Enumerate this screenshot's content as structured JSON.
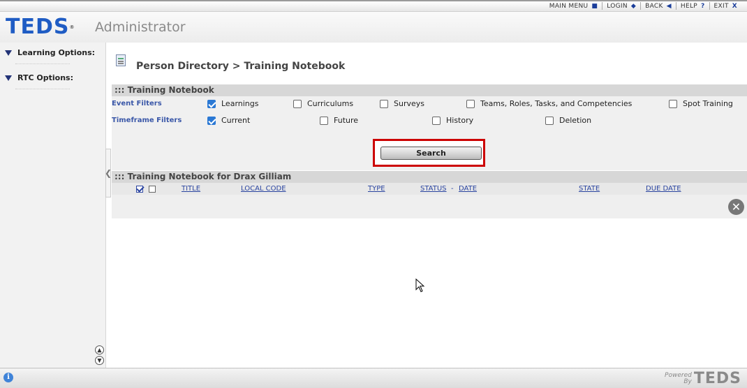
{
  "topnav": {
    "main_menu": "MAIN MENU",
    "main_menu_icon": "■",
    "login": "LOGIN",
    "login_icon": "◆",
    "back": "BACK",
    "back_icon": "◀",
    "help": "HELP",
    "help_icon": "?",
    "exit": "EXIT",
    "exit_icon": "X"
  },
  "header": {
    "logo": "TEDS",
    "logo_mark": "®",
    "subtitle": "Administrator"
  },
  "sidebar": {
    "items": [
      {
        "label": "Learning Options:"
      },
      {
        "label": "RTC Options:"
      }
    ],
    "collapse_icon": "❮",
    "scroll_up_icon": "▲",
    "scroll_down_icon": "▼"
  },
  "breadcrumb": "Person Directory > Training Notebook",
  "notebook_section": {
    "title": "::: Training Notebook",
    "event_filters_label": "Event Filters",
    "event_filters": [
      {
        "label": "Learnings",
        "checked": true
      },
      {
        "label": "Curriculums",
        "checked": false
      },
      {
        "label": "Surveys",
        "checked": false
      },
      {
        "label": "Teams, Roles, Tasks, and Competencies",
        "checked": false
      },
      {
        "label": "Spot Training",
        "checked": false
      }
    ],
    "timeframe_filters_label": "Timeframe Filters",
    "timeframe_filters": [
      {
        "label": "Current",
        "checked": true
      },
      {
        "label": "Future",
        "checked": false
      },
      {
        "label": "History",
        "checked": false
      },
      {
        "label": "Deletion",
        "checked": false
      }
    ],
    "search_label": "Search"
  },
  "results_section": {
    "title": "::: Training Notebook for Drax Gilliam",
    "columns": {
      "title": "TITLE",
      "local_code": "LOCAL CODE",
      "type": "TYPE",
      "status": "STATUS",
      "status_sep": "-",
      "date": "DATE",
      "state": "STATE",
      "due_date": "DUE DATE"
    },
    "close_icon": "✕"
  },
  "footer": {
    "info_icon": "i",
    "powered": "Powered",
    "by": "By",
    "logo": "TEDS"
  },
  "colors": {
    "accent": "#1f5cc4",
    "highlight_border": "#cc0000",
    "section_header": "#d7d7d7"
  }
}
